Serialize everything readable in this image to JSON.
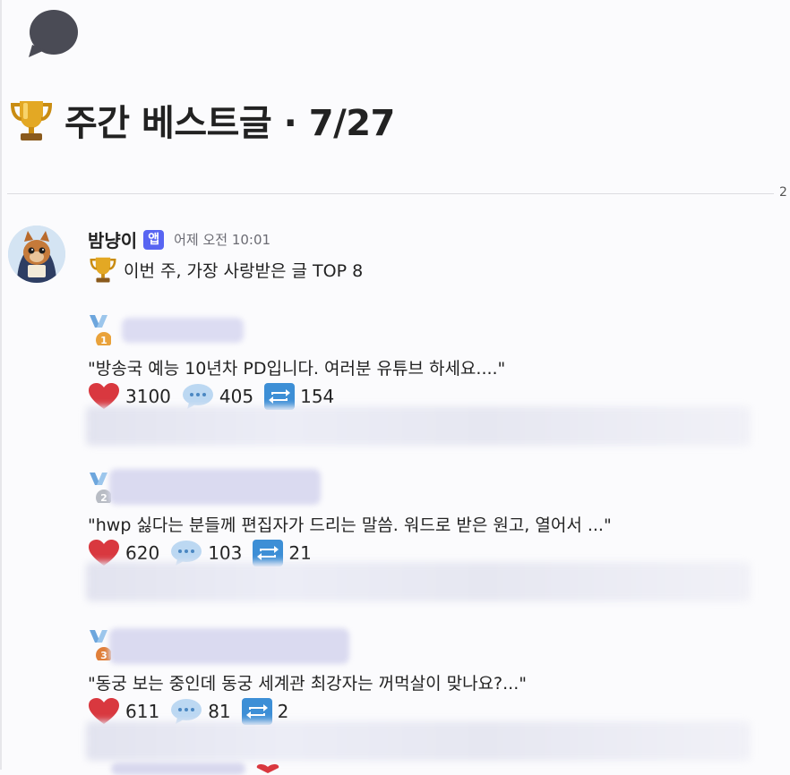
{
  "header": {
    "title": "주간 베스트글 · 7/27",
    "edge_number": "2"
  },
  "message": {
    "author": "밤냥이",
    "badge": "앱",
    "timestamp": "어제 오전 10:01",
    "intro": "이번 주, 가장 사랑받은 글 TOP 8"
  },
  "posts": [
    {
      "rank": "1",
      "quote": "\"방송국 예능 10년차 PD입니다. 여러분 유튜브 하세요....\"",
      "likes": "3100",
      "comments": "405",
      "reposts": "154",
      "medal_color": "#e9a23b"
    },
    {
      "rank": "2",
      "quote": "\"hwp 싫다는 분들께 편집자가 드리는 말씀. 워드로 받은 원고, 열어서 ...\"",
      "likes": "620",
      "comments": "103",
      "reposts": "21",
      "medal_color": "#b8bcc4"
    },
    {
      "rank": "3",
      "quote": "\"동궁 보는 중인데 동궁 세계관 최강자는 꺼먹살이 맞나요?...\"",
      "likes": "611",
      "comments": "81",
      "reposts": "2",
      "medal_color": "#e07f3a"
    }
  ],
  "colors": {
    "heart": "#d9383f",
    "comment_bubble": "#bcd8f2",
    "repost": "#3d8fd6",
    "badge": "#5865f2"
  },
  "icons": [
    "speech-bubble-icon",
    "trophy-icon",
    "medal-icon",
    "heart-icon",
    "comment-icon",
    "repost-icon"
  ]
}
